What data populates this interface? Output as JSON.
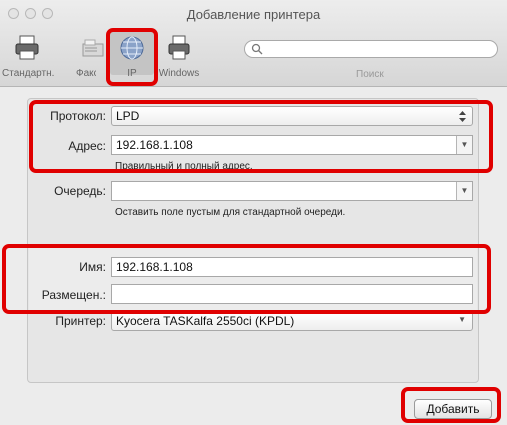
{
  "window": {
    "title": "Добавление принтера"
  },
  "toolbar": {
    "items": [
      {
        "label": "Стандартн.",
        "icon": "printer-icon"
      },
      {
        "label": "Факс",
        "icon": "fax-icon"
      },
      {
        "label": "IP",
        "icon": "globe-icon"
      },
      {
        "label": "Windows",
        "icon": "windows-printer-icon"
      }
    ],
    "search_label": "Поиск"
  },
  "form": {
    "protocol_label": "Протокол:",
    "protocol_value": "LPD",
    "address_label": "Адрес:",
    "address_value": "192.168.1.108",
    "address_hint": "Правильный и полный адрес.",
    "queue_label": "Очередь:",
    "queue_value": "",
    "queue_hint": "Оставить поле пустым для стандартной очереди.",
    "name_label": "Имя:",
    "name_value": "192.168.1.108",
    "location_label": "Размещен.:",
    "location_value": "",
    "printer_label": "Принтер:",
    "printer_value": "Kyocera TASKalfa 2550ci (KPDL)"
  },
  "actions": {
    "add_label": "Добавить"
  },
  "colors": {
    "highlight": "#e00000"
  }
}
